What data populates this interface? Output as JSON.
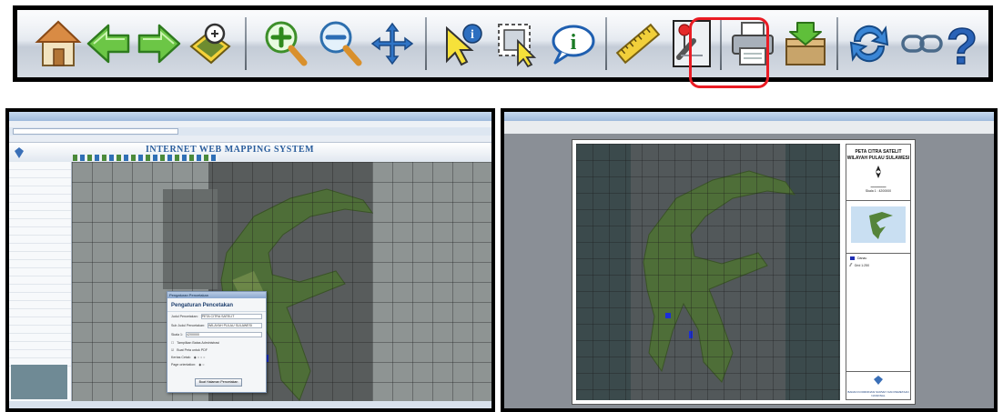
{
  "toolbar": {
    "buttons": [
      {
        "name": "home",
        "icon": "home-icon"
      },
      {
        "name": "back",
        "icon": "back-arrow-icon"
      },
      {
        "name": "forward",
        "icon": "forward-arrow-icon"
      },
      {
        "name": "zoom-extent",
        "icon": "zoom-extent-icon"
      },
      {
        "name": "zoom-in",
        "icon": "zoom-in-icon"
      },
      {
        "name": "zoom-out",
        "icon": "zoom-out-icon"
      },
      {
        "name": "pan",
        "icon": "pan-icon"
      },
      {
        "name": "identify",
        "icon": "identify-icon"
      },
      {
        "name": "select",
        "icon": "select-icon"
      },
      {
        "name": "info",
        "icon": "info-icon"
      },
      {
        "name": "measure",
        "icon": "ruler-icon"
      },
      {
        "name": "print-layout",
        "icon": "print-layout-icon"
      },
      {
        "name": "print",
        "icon": "printer-icon"
      },
      {
        "name": "download",
        "icon": "download-icon"
      },
      {
        "name": "refresh",
        "icon": "refresh-icon"
      },
      {
        "name": "link",
        "icon": "link-icon"
      },
      {
        "name": "help",
        "icon": "help-icon"
      }
    ],
    "highlight_color": "#ea1c24"
  },
  "left_screenshot": {
    "app_title": "INTERNET WEB MAPPING SYSTEM",
    "dialog": {
      "title": "Pengaturan Pencetakan",
      "heading": "Pengaturan Pencetakan",
      "fields": [
        {
          "label": "Judul Pencetakan:",
          "value": "PETA CITRA SATELIT"
        },
        {
          "label": "Sub Judul Pencetakan:",
          "value": "WILAYAH PULAU SULAWESI"
        },
        {
          "label": "Skala 1:",
          "value": "4200000"
        }
      ],
      "checkboxes": [
        "Tampilkan Batas Administrasi",
        "Buat Peta untuk PDF"
      ],
      "paper_label": "Kertas Cetak:",
      "orientation_label": "Page orientation:",
      "button": "Buat Halaman Pencetakan"
    }
  },
  "right_screenshot": {
    "legend": {
      "title_line1": "PETA CITRA SATELIT",
      "title_line2": "WILAYAH PULAU SULAWESI",
      "scale_text": "Skala 1 : 4200000",
      "items": [
        {
          "label": "Danau",
          "color": "#1f2fb3"
        },
        {
          "label": "Grid 1:250"
        }
      ],
      "footer": "BADAN KOORDINASI SURVEY DAN PEMETAAN NASIONAL"
    }
  }
}
